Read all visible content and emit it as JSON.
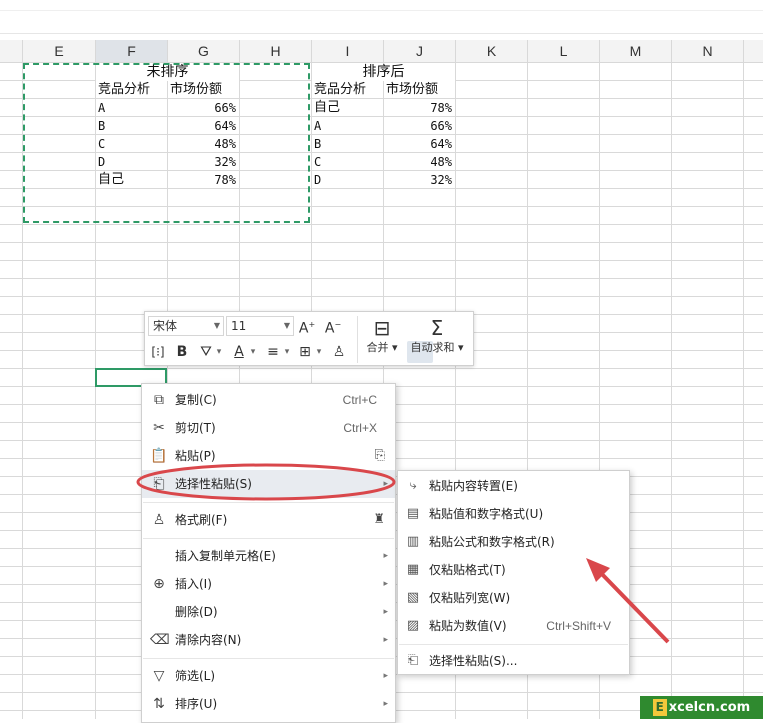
{
  "columns": [
    {
      "label": "E",
      "selected": false
    },
    {
      "label": "F",
      "selected": true
    },
    {
      "label": "G",
      "selected": false
    },
    {
      "label": "H",
      "selected": false
    },
    {
      "label": "I",
      "selected": false
    },
    {
      "label": "J",
      "selected": false
    },
    {
      "label": "K",
      "selected": false
    },
    {
      "label": "L",
      "selected": false
    },
    {
      "label": "M",
      "selected": false
    },
    {
      "label": "N",
      "selected": false
    }
  ],
  "left_table": {
    "title": "未排序",
    "headers": [
      "竞品分析",
      "市场份额"
    ],
    "rows": [
      {
        "name": "A",
        "value": "66%"
      },
      {
        "name": "B",
        "value": "64%"
      },
      {
        "name": "C",
        "value": "48%"
      },
      {
        "name": "D",
        "value": "32%"
      },
      {
        "name": "自己",
        "value": "78%"
      }
    ]
  },
  "right_table": {
    "title": "排序后",
    "headers": [
      "竞品分析",
      "市场份额"
    ],
    "rows": [
      {
        "name": "自己",
        "value": "78%"
      },
      {
        "name": "A",
        "value": "66%"
      },
      {
        "name": "B",
        "value": "64%"
      },
      {
        "name": "C",
        "value": "48%"
      },
      {
        "name": "D",
        "value": "32%"
      }
    ]
  },
  "mini_toolbar": {
    "font_name": "宋体",
    "font_size": "11",
    "merge_label": "合并",
    "autosum_label": "自动求和"
  },
  "context_menu": {
    "copy": {
      "label": "复制(C)",
      "shortcut": "Ctrl+C"
    },
    "cut": {
      "label": "剪切(T)",
      "shortcut": "Ctrl+X"
    },
    "paste": {
      "label": "粘贴(P)"
    },
    "paste_special": {
      "label": "选择性粘贴(S)"
    },
    "format_painter": {
      "label": "格式刷(F)"
    },
    "insert_copied": {
      "label": "插入复制单元格(E)"
    },
    "insert": {
      "label": "插入(I)"
    },
    "delete": {
      "label": "删除(D)"
    },
    "clear": {
      "label": "清除内容(N)"
    },
    "filter": {
      "label": "筛选(L)"
    },
    "sort": {
      "label": "排序(U)"
    }
  },
  "submenu": {
    "transpose": {
      "label": "粘贴内容转置(E)"
    },
    "values_numfmt": {
      "label": "粘贴值和数字格式(U)"
    },
    "formula_numfmt": {
      "label": "粘贴公式和数字格式(R)"
    },
    "format_only": {
      "label": "仅粘贴格式(T)"
    },
    "col_width": {
      "label": "仅粘贴列宽(W)"
    },
    "as_values": {
      "label": "粘贴为数值(V)",
      "shortcut": "Ctrl+Shift+V"
    },
    "paste_special": {
      "label": "选择性粘贴(S)..."
    }
  },
  "annotation_color": "#d9474b",
  "accent_color": "#2e9a66",
  "watermark": {
    "letter": "E",
    "text": "xcelcn.com"
  }
}
